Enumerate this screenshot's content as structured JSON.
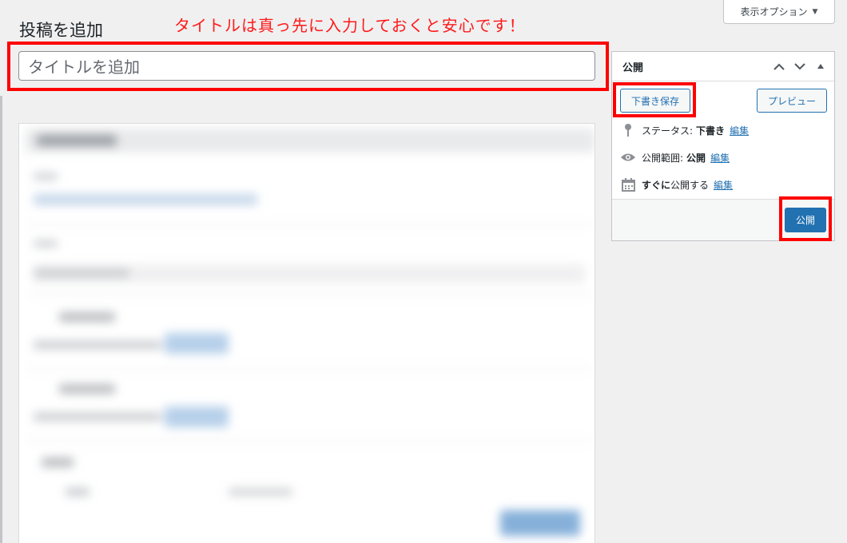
{
  "header": {
    "screen_options_label": "表示オプション",
    "page_title": "投稿を追加",
    "annotation": "タイトルは真っ先に入力しておくと安心です！"
  },
  "title_field": {
    "placeholder": "タイトルを追加",
    "value": ""
  },
  "publish_box": {
    "title": "公開",
    "save_draft_label": "下書き保存",
    "preview_label": "プレビュー",
    "status_label": "ステータス:",
    "status_value": "下書き",
    "visibility_label": "公開範囲:",
    "visibility_value": "公開",
    "schedule_value": "すぐに",
    "schedule_suffix": "公開する",
    "edit_label": "編集",
    "publish_label": "公開"
  },
  "icons": {
    "status": "pin-icon",
    "visibility": "eye-icon",
    "schedule": "calendar-icon",
    "move_up": "chevron-up-icon",
    "move_down": "chevron-down-icon",
    "toggle": "triangle-up-icon"
  },
  "colors": {
    "annotation": "#ff1a1a",
    "highlight_border": "#ff0000",
    "primary": "#2271b1",
    "background": "#f0f0f1"
  }
}
